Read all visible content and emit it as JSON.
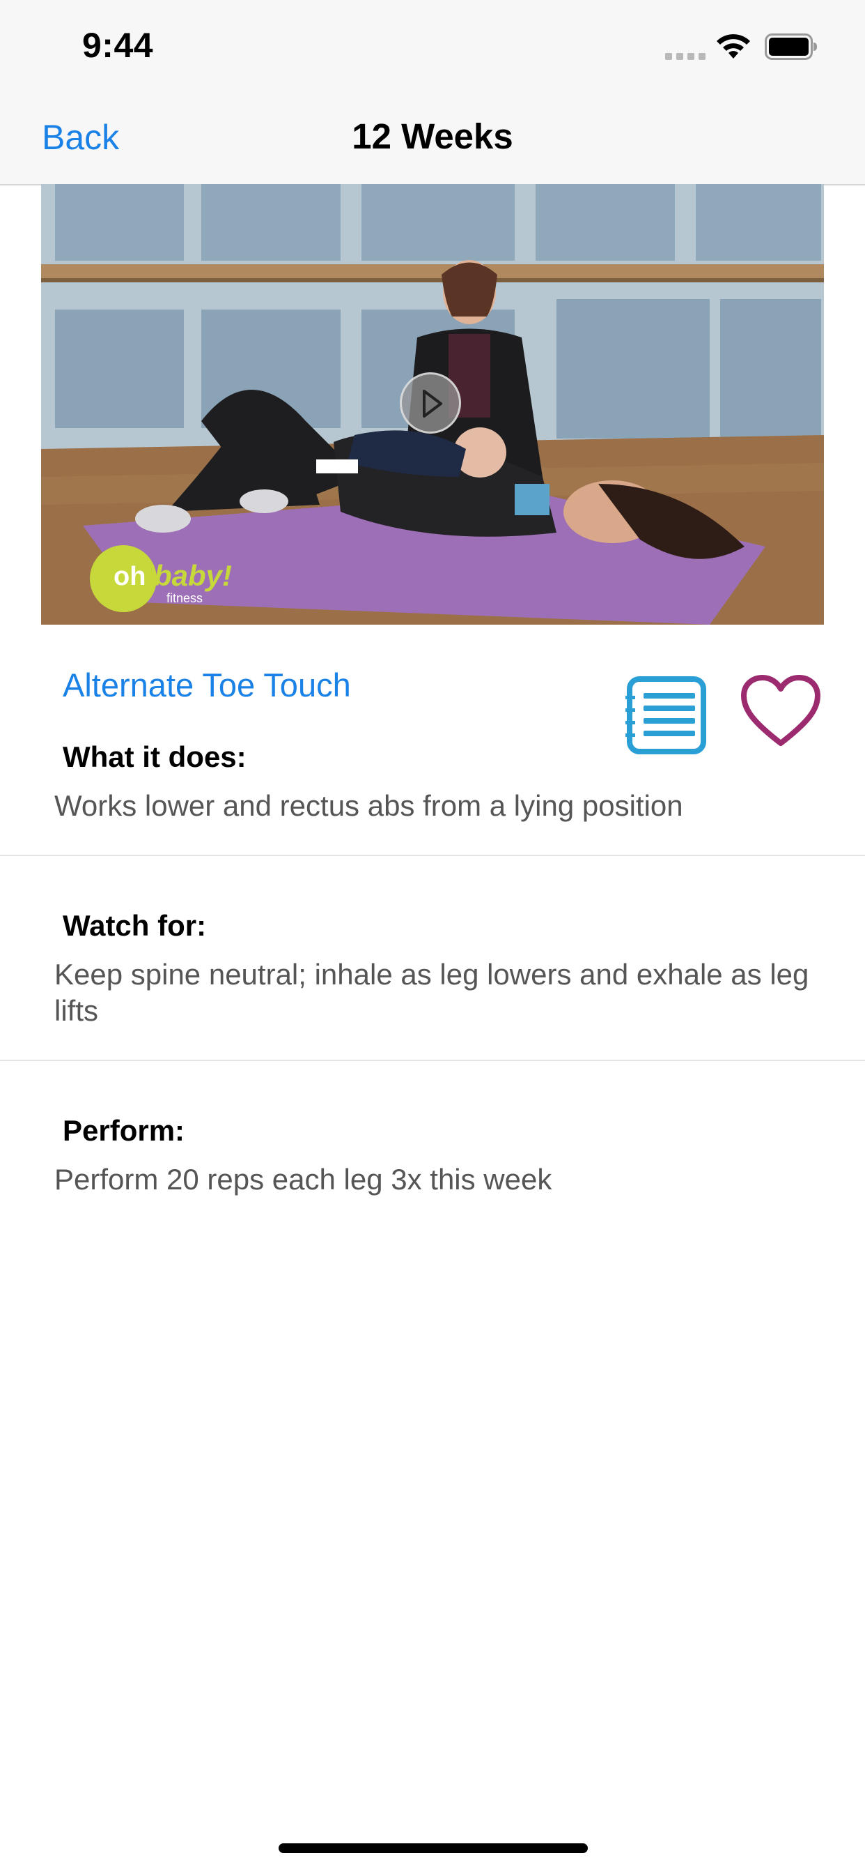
{
  "status_bar": {
    "time": "9:44"
  },
  "nav": {
    "back_label": "Back",
    "title": "12 Weeks"
  },
  "video": {
    "logo_oh": "oh",
    "logo_baby": "baby!",
    "logo_fitness": "fitness"
  },
  "exercise": {
    "name": "Alternate Toe Touch"
  },
  "sections": [
    {
      "label": "What it does:",
      "text": "Works lower and rectus abs from a lying position"
    },
    {
      "label": "Watch for:",
      "text": "Keep spine neutral; inhale as leg lowers and exhale as leg lifts"
    },
    {
      "label": "Perform:",
      "text": "Perform 20 reps each leg 3x this week"
    }
  ],
  "colors": {
    "link": "#1a82e6",
    "heart": "#9c2a6e",
    "notes": "#2a9fd6",
    "body_text": "#555555"
  },
  "icons": {
    "notes": "notes-list-icon",
    "favorite": "heart-icon",
    "play": "play-icon"
  }
}
